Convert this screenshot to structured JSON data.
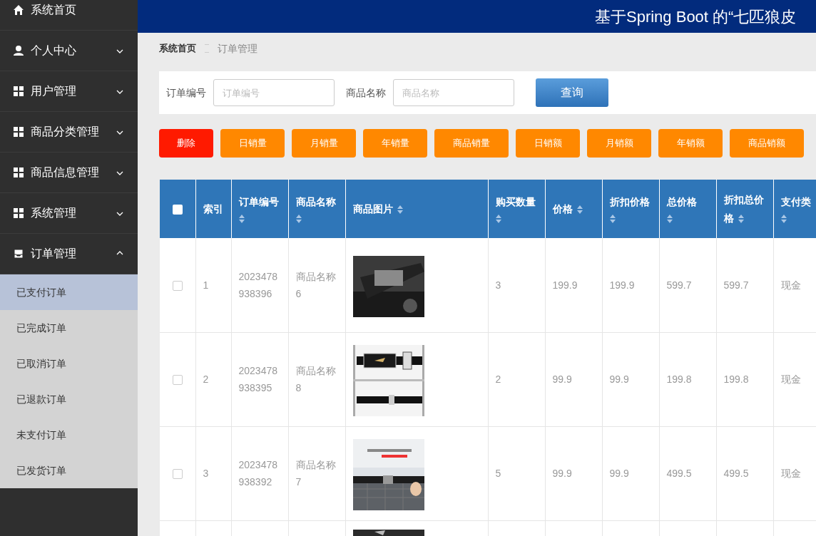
{
  "header": {
    "title": "基于Spring Boot 的“七匹狼皮"
  },
  "sidebar": {
    "items": [
      {
        "label": "系统首页"
      },
      {
        "label": "个人中心",
        "expanded": false
      },
      {
        "label": "用户管理",
        "expanded": false
      },
      {
        "label": "商品分类管理",
        "expanded": false
      },
      {
        "label": "商品信息管理",
        "expanded": false
      },
      {
        "label": "系统管理",
        "expanded": false
      },
      {
        "label": "订单管理",
        "expanded": true,
        "children": [
          {
            "label": "已支付订单",
            "selected": true
          },
          {
            "label": "已完成订单",
            "selected": false
          },
          {
            "label": "已取消订单",
            "selected": false
          },
          {
            "label": "已退款订单",
            "selected": false
          },
          {
            "label": "未支付订单",
            "selected": false
          },
          {
            "label": "已发货订单",
            "selected": false
          }
        ]
      }
    ]
  },
  "breadcrumb": [
    "系统首页",
    "订单管理"
  ],
  "search": {
    "fields": [
      {
        "label": "订单编号",
        "placeholder": "订单编号"
      },
      {
        "label": "商品名称",
        "placeholder": "商品名称"
      }
    ],
    "button": "查询"
  },
  "actions": [
    {
      "label": "删除",
      "kind": "danger"
    },
    {
      "label": "日销量",
      "kind": "warning"
    },
    {
      "label": "月销量",
      "kind": "warning"
    },
    {
      "label": "年销量",
      "kind": "warning"
    },
    {
      "label": "商品销量",
      "kind": "warning"
    },
    {
      "label": "日销额",
      "kind": "warning"
    },
    {
      "label": "月销额",
      "kind": "warning"
    },
    {
      "label": "年销额",
      "kind": "warning"
    },
    {
      "label": "商品销额",
      "kind": "warning"
    }
  ],
  "table": {
    "select_all_checked": false,
    "columns": [
      {
        "label": "索引",
        "sortable": false
      },
      {
        "label": "订单编号",
        "sortable": true
      },
      {
        "label": "商品名称",
        "sortable": true
      },
      {
        "label": "商品图片",
        "sortable": true
      },
      {
        "label": "购买数量",
        "sortable": true
      },
      {
        "label": "价格",
        "sortable": true
      },
      {
        "label": "折扣价格",
        "sortable": true
      },
      {
        "label": "总价格",
        "sortable": true
      },
      {
        "label": "折扣总价格",
        "sortable": true
      },
      {
        "label": "支付类",
        "sortable": true
      }
    ],
    "rows": [
      {
        "checked": false,
        "cells": [
          "1",
          "2023478938396",
          "商品名称6",
          null,
          "3",
          "199.9",
          "199.9",
          "599.7",
          "599.7",
          "现金"
        ]
      },
      {
        "checked": false,
        "cells": [
          "2",
          "2023478938395",
          "商品名称8",
          null,
          "2",
          "99.9",
          "99.9",
          "199.8",
          "199.8",
          "现金"
        ]
      },
      {
        "checked": false,
        "cells": [
          "3",
          "2023478938392",
          "商品名称7",
          null,
          "5",
          "99.9",
          "99.9",
          "499.5",
          "499.5",
          "现金"
        ]
      }
    ]
  }
}
